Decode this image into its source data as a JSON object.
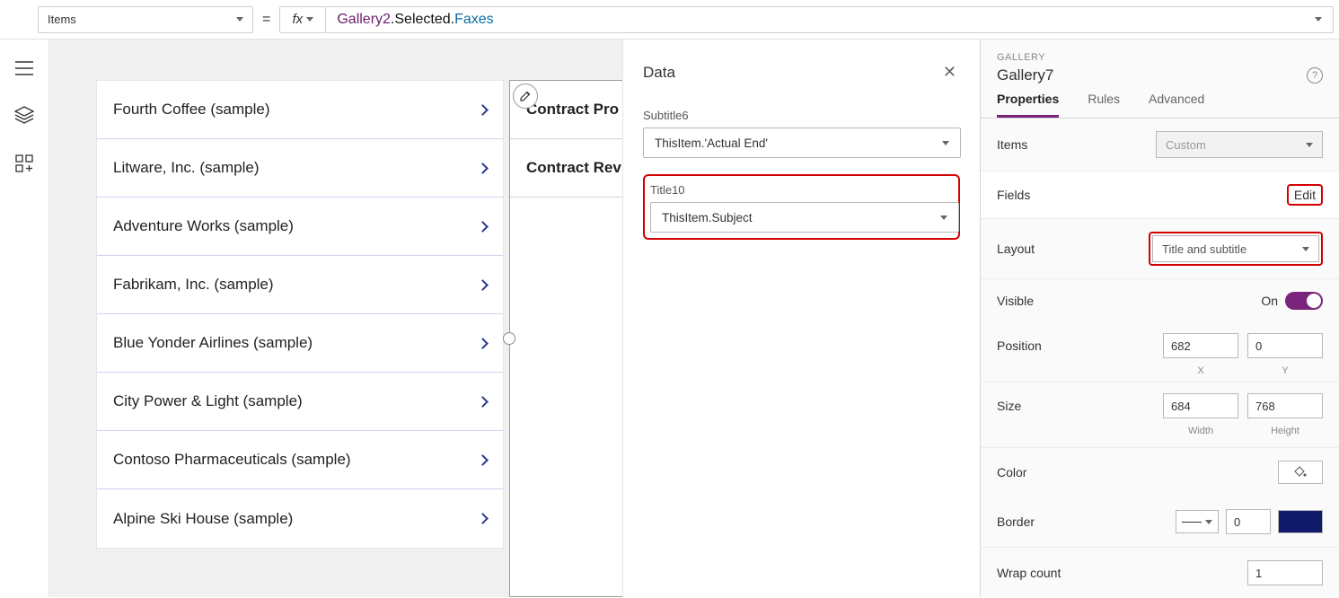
{
  "formula_bar": {
    "property": "Items",
    "formula_object": "Gallery2",
    "formula_prop": ".Selected.",
    "formula_ref": "Faxes"
  },
  "left_gallery": {
    "items": [
      {
        "title": "Fourth Coffee (sample)"
      },
      {
        "title": "Litware, Inc. (sample)"
      },
      {
        "title": "Adventure Works (sample)"
      },
      {
        "title": "Fabrikam, Inc. (sample)"
      },
      {
        "title": "Blue Yonder Airlines (sample)"
      },
      {
        "title": "City Power & Light (sample)"
      },
      {
        "title": "Contoso Pharmaceuticals (sample)"
      },
      {
        "title": "Alpine Ski House (sample)"
      }
    ]
  },
  "right_gallery": {
    "items": [
      {
        "title": "Contract Pro"
      },
      {
        "title": "Contract Rev"
      }
    ]
  },
  "data_panel": {
    "title": "Data",
    "fields": [
      {
        "label": "Subtitle6",
        "value": "ThisItem.'Actual End'"
      },
      {
        "label": "Title10",
        "value": "ThisItem.Subject"
      }
    ]
  },
  "props_panel": {
    "type": "GALLERY",
    "name": "Gallery7",
    "tabs": [
      "Properties",
      "Rules",
      "Advanced"
    ],
    "items": {
      "label": "Items",
      "value": "Custom"
    },
    "fields": {
      "label": "Fields",
      "link": "Edit"
    },
    "layout": {
      "label": "Layout",
      "value": "Title and subtitle"
    },
    "visible": {
      "label": "Visible",
      "state": "On"
    },
    "position": {
      "label": "Position",
      "x": "682",
      "y": "0",
      "x_lbl": "X",
      "y_lbl": "Y"
    },
    "size": {
      "label": "Size",
      "w": "684",
      "h": "768",
      "w_lbl": "Width",
      "h_lbl": "Height"
    },
    "color": {
      "label": "Color",
      "value": "#ffffff"
    },
    "border": {
      "label": "Border",
      "width": "0",
      "color": "#101a6b"
    },
    "wrap_count": {
      "label": "Wrap count",
      "value": "1"
    }
  }
}
